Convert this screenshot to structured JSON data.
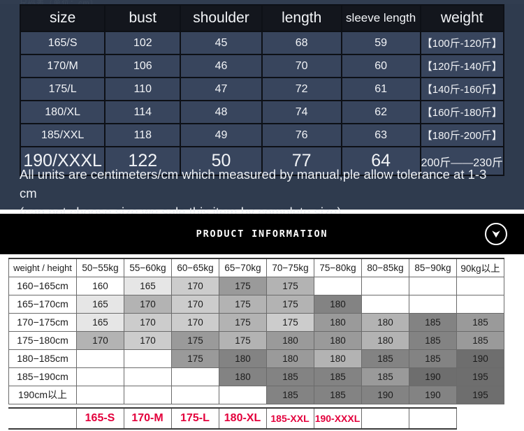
{
  "size_table": {
    "ghost_top_text": "尺码表（单位：cm）",
    "headers": [
      "size",
      "bust",
      "shoulder",
      "length",
      "sleeve length",
      "weight"
    ],
    "rows": [
      {
        "size": "165/S",
        "bust": "102",
        "shoulder": "45",
        "length": "68",
        "sleeve": "59",
        "weight": "【100斤-120斤】"
      },
      {
        "size": "170/M",
        "bust": "106",
        "shoulder": "46",
        "length": "70",
        "sleeve": "60",
        "weight": "【120斤-140斤】"
      },
      {
        "size": "175/L",
        "bust": "110",
        "shoulder": "47",
        "length": "72",
        "sleeve": "61",
        "weight": "【140斤-160斤】"
      },
      {
        "size": "180/XL",
        "bust": "114",
        "shoulder": "48",
        "length": "74",
        "sleeve": "62",
        "weight": "【160斤-180斤】"
      },
      {
        "size": "185/XXL",
        "bust": "118",
        "shoulder": "49",
        "length": "76",
        "sleeve": "63",
        "weight": "【180斤-200斤】"
      },
      {
        "size": "190/XXXL",
        "bust": "122",
        "shoulder": "50",
        "length": "77",
        "sleeve": "64",
        "weight": "200斤——230斤"
      }
    ],
    "note_line1": "All units are centimeters/cm which measured by manual,ple allow tolerance at 1-3 cm",
    "note_line2": "(can not choose size,we sale this item by complete size)"
  },
  "banner": {
    "title": "PRODUCT  INFORMATION",
    "chevron_icon": "chevron-down-icon",
    "background": "#000000"
  },
  "matrix_table": {
    "corner_label": "weight / height",
    "weight_columns": [
      "50−55kg",
      "55−60kg",
      "60−65kg",
      "65−70kg",
      "70−75kg",
      "75−80kg",
      "80−85kg",
      "85−90kg",
      "90kg以上"
    ],
    "height_rows": [
      "160−165cm",
      "165−170cm",
      "170−175cm",
      "175−180cm",
      "180−185cm",
      "185−190cm",
      "190cm以上"
    ],
    "cells": [
      [
        {
          "v": "160",
          "s": 0
        },
        {
          "v": "165",
          "s": 1
        },
        {
          "v": "170",
          "s": 2
        },
        {
          "v": "175",
          "s": 4
        },
        {
          "v": "175",
          "s": 3
        },
        {
          "v": "",
          "s": 0
        },
        {
          "v": "",
          "s": 0
        },
        {
          "v": "",
          "s": 0
        },
        {
          "v": "",
          "s": 0
        }
      ],
      [
        {
          "v": "165",
          "s": 1
        },
        {
          "v": "170",
          "s": 3
        },
        {
          "v": "170",
          "s": 2
        },
        {
          "v": "175",
          "s": 3
        },
        {
          "v": "175",
          "s": 3
        },
        {
          "v": "180",
          "s": 5
        },
        {
          "v": "",
          "s": 0
        },
        {
          "v": "",
          "s": 0
        },
        {
          "v": "",
          "s": 0
        }
      ],
      [
        {
          "v": "165",
          "s": 1
        },
        {
          "v": "170",
          "s": 2
        },
        {
          "v": "170",
          "s": 2
        },
        {
          "v": "175",
          "s": 3
        },
        {
          "v": "175",
          "s": 2
        },
        {
          "v": "180",
          "s": 4
        },
        {
          "v": "180",
          "s": 3
        },
        {
          "v": "185",
          "s": 5
        },
        {
          "v": "185",
          "s": 4
        }
      ],
      [
        {
          "v": "170",
          "s": 3
        },
        {
          "v": "170",
          "s": 2
        },
        {
          "v": "175",
          "s": 4
        },
        {
          "v": "175",
          "s": 3
        },
        {
          "v": "180",
          "s": 4
        },
        {
          "v": "180",
          "s": 4
        },
        {
          "v": "180",
          "s": 3
        },
        {
          "v": "185",
          "s": 5
        },
        {
          "v": "185",
          "s": 4
        }
      ],
      [
        {
          "v": "",
          "s": 0
        },
        {
          "v": "",
          "s": 0
        },
        {
          "v": "175",
          "s": 4
        },
        {
          "v": "180",
          "s": 5
        },
        {
          "v": "180",
          "s": 4
        },
        {
          "v": "180",
          "s": 3
        },
        {
          "v": "185",
          "s": 5
        },
        {
          "v": "185",
          "s": 5
        },
        {
          "v": "190",
          "s": 6
        }
      ],
      [
        {
          "v": "",
          "s": 0
        },
        {
          "v": "",
          "s": 0
        },
        {
          "v": "",
          "s": 0
        },
        {
          "v": "180",
          "s": 5
        },
        {
          "v": "185",
          "s": 5
        },
        {
          "v": "185",
          "s": 5
        },
        {
          "v": "185",
          "s": 4
        },
        {
          "v": "190",
          "s": 6
        },
        {
          "v": "195",
          "s": 6
        }
      ],
      [
        {
          "v": "",
          "s": 0
        },
        {
          "v": "",
          "s": 0
        },
        {
          "v": "",
          "s": 0
        },
        {
          "v": "",
          "s": 0
        },
        {
          "v": "185",
          "s": 5
        },
        {
          "v": "185",
          "s": 5
        },
        {
          "v": "190",
          "s": 5
        },
        {
          "v": "190",
          "s": 5
        },
        {
          "v": "195",
          "s": 6
        }
      ]
    ]
  },
  "legend_row": {
    "labels": [
      "165-S",
      "170-M",
      "175-L",
      "180-XL",
      "185-XXL",
      "190-XXXL",
      "",
      ""
    ],
    "color": "#e3003c"
  }
}
